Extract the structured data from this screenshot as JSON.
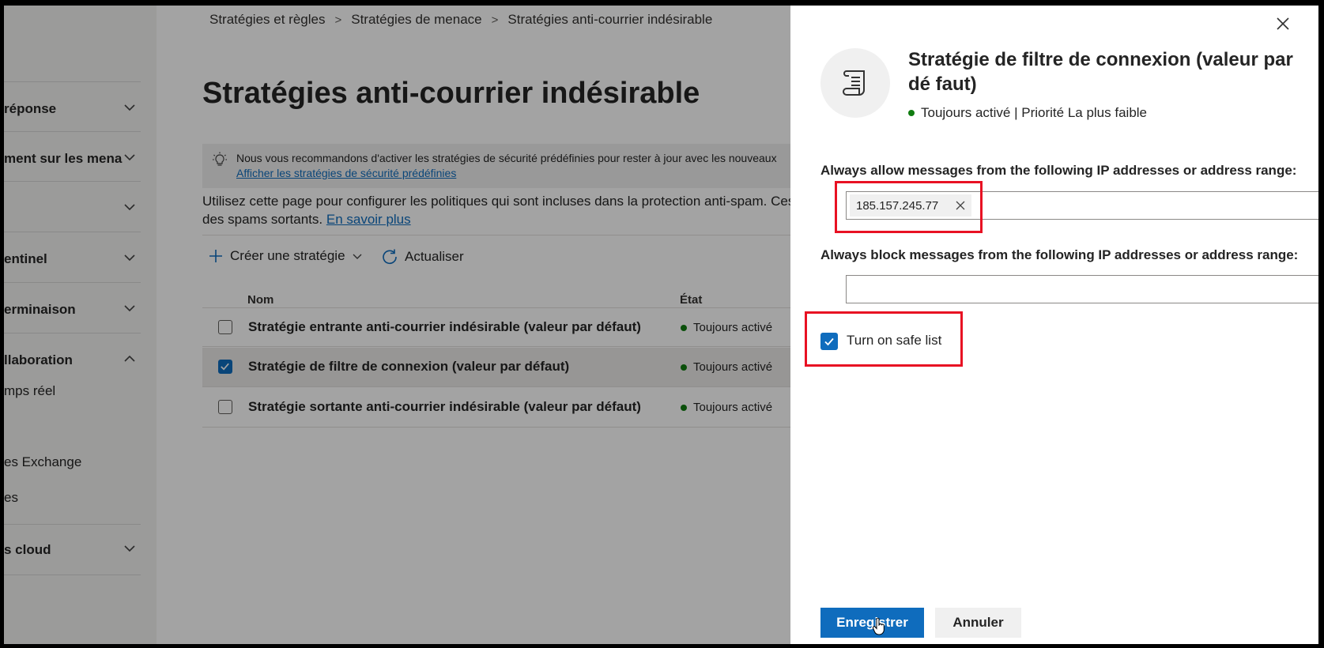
{
  "nav": {
    "items": [
      {
        "label": "réponse",
        "expanded": false
      },
      {
        "label": "ment sur les menac",
        "expanded": false
      },
      {
        "label": "",
        "expanded": false
      },
      {
        "label": "entinel",
        "expanded": false
      },
      {
        "label": "erminaison",
        "expanded": false
      },
      {
        "label": "llaboration",
        "expanded": true
      }
    ],
    "sub_items": [
      "mps réel",
      "es Exchange",
      "es"
    ],
    "bottom_item": {
      "label": "s cloud",
      "expanded": false
    }
  },
  "breadcrumb": [
    "Stratégies et règles",
    "Stratégies de menace",
    "Stratégies anti-courrier indésirable"
  ],
  "page": {
    "title": "Stratégies anti-courrier indésirable",
    "banner_text": "Nous vous recommandons d'activer les stratégies de sécurité prédéfinies pour rester à jour avec les nouveaux",
    "banner_link": "Afficher les stratégies de sécurité prédéfinies",
    "description": "Utilisez cette page pour configurer les politiques qui sont incluses dans la protection anti-spam. Ces",
    "description_line2": "des spams sortants.",
    "learn_more": "En savoir plus"
  },
  "toolbar": {
    "create_label": "Créer une stratégie",
    "refresh_label": "Actualiser"
  },
  "table": {
    "columns": [
      "Nom",
      "État"
    ],
    "rows": [
      {
        "name": "Stratégie entrante anti-courrier indésirable (valeur par défaut)",
        "state": "Toujours activé",
        "selected": false
      },
      {
        "name": "Stratégie de filtre de connexion (valeur par défaut)",
        "state": "Toujours activé",
        "selected": true
      },
      {
        "name": "Stratégie sortante anti-courrier indésirable (valeur par défaut)",
        "state": "Toujours activé",
        "selected": false
      }
    ]
  },
  "panel": {
    "title": "Stratégie de filtre de connexion (valeur par dé faut)",
    "status": "Toujours activé | Priorité La plus faible",
    "allow_label": "Always allow messages from the following IP addresses or address range:",
    "allow_tags": [
      "185.157.245.77"
    ],
    "block_label": "Always block messages from the following IP addresses or address range:",
    "block_value": "",
    "safe_list_label": "Turn on safe list",
    "safe_list_checked": true,
    "save_label": "Enregistrer",
    "cancel_label": "Annuler"
  },
  "colors": {
    "accent": "#0f6cbd",
    "status_green": "#107c10",
    "highlight_red": "#e81123"
  },
  "icons": [
    "chevron-down-icon",
    "chevron-up-icon",
    "lightbulb-icon",
    "plus-icon",
    "refresh-icon",
    "checkmark-icon",
    "close-icon",
    "scroll-document-icon",
    "pointer-hand-icon"
  ]
}
